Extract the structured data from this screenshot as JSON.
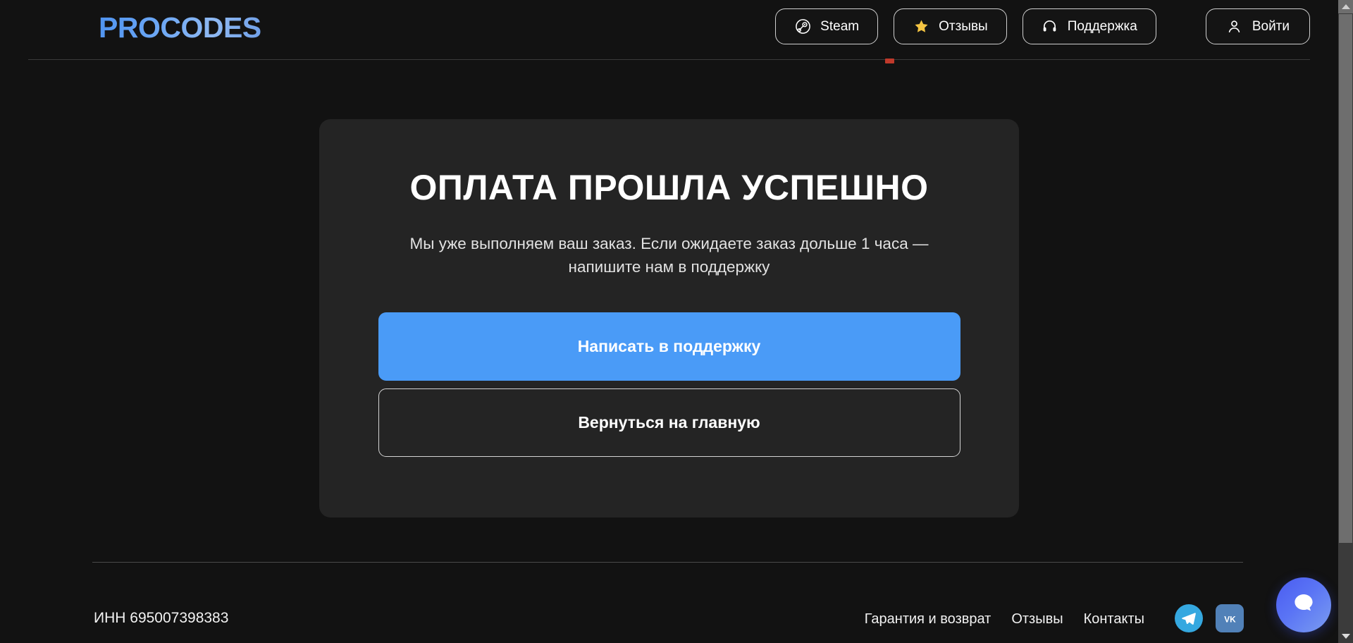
{
  "brand": {
    "logo_text": "PROCODES"
  },
  "header": {
    "nav": [
      {
        "label": "Steam",
        "icon": "steam-icon"
      },
      {
        "label": "Отзывы",
        "icon": "star-icon"
      },
      {
        "label": "Поддержка",
        "icon": "headset-icon"
      }
    ],
    "login": {
      "label": "Войти",
      "icon": "user-icon"
    }
  },
  "main": {
    "title": "ОПЛАТА ПРОШЛА УСПЕШНО",
    "subtitle": "Мы уже выполняем ваш заказ. Если ожидаете заказ дольше 1 часа — напишите нам в поддержку",
    "primary_button": "Написать в поддержку",
    "secondary_button": "Вернуться на главную"
  },
  "footer": {
    "inn": "ИНН 695007398383",
    "links": [
      {
        "label": "Гарантия и возврат"
      },
      {
        "label": "Отзывы"
      },
      {
        "label": "Контакты"
      }
    ],
    "socials": [
      {
        "name": "telegram-icon"
      },
      {
        "name": "vk-icon",
        "label": "VK"
      }
    ]
  },
  "widgets": {
    "chat": {
      "icon": "chat-bubble-icon"
    }
  },
  "colors": {
    "page_bg": "#121212",
    "card_bg": "#242424",
    "accent_blue": "#4a9bf7",
    "logo_blue": "#6aa6f5",
    "star_yellow": "#f5c542",
    "telegram": "#35a8e0",
    "vk": "#5181b8"
  }
}
